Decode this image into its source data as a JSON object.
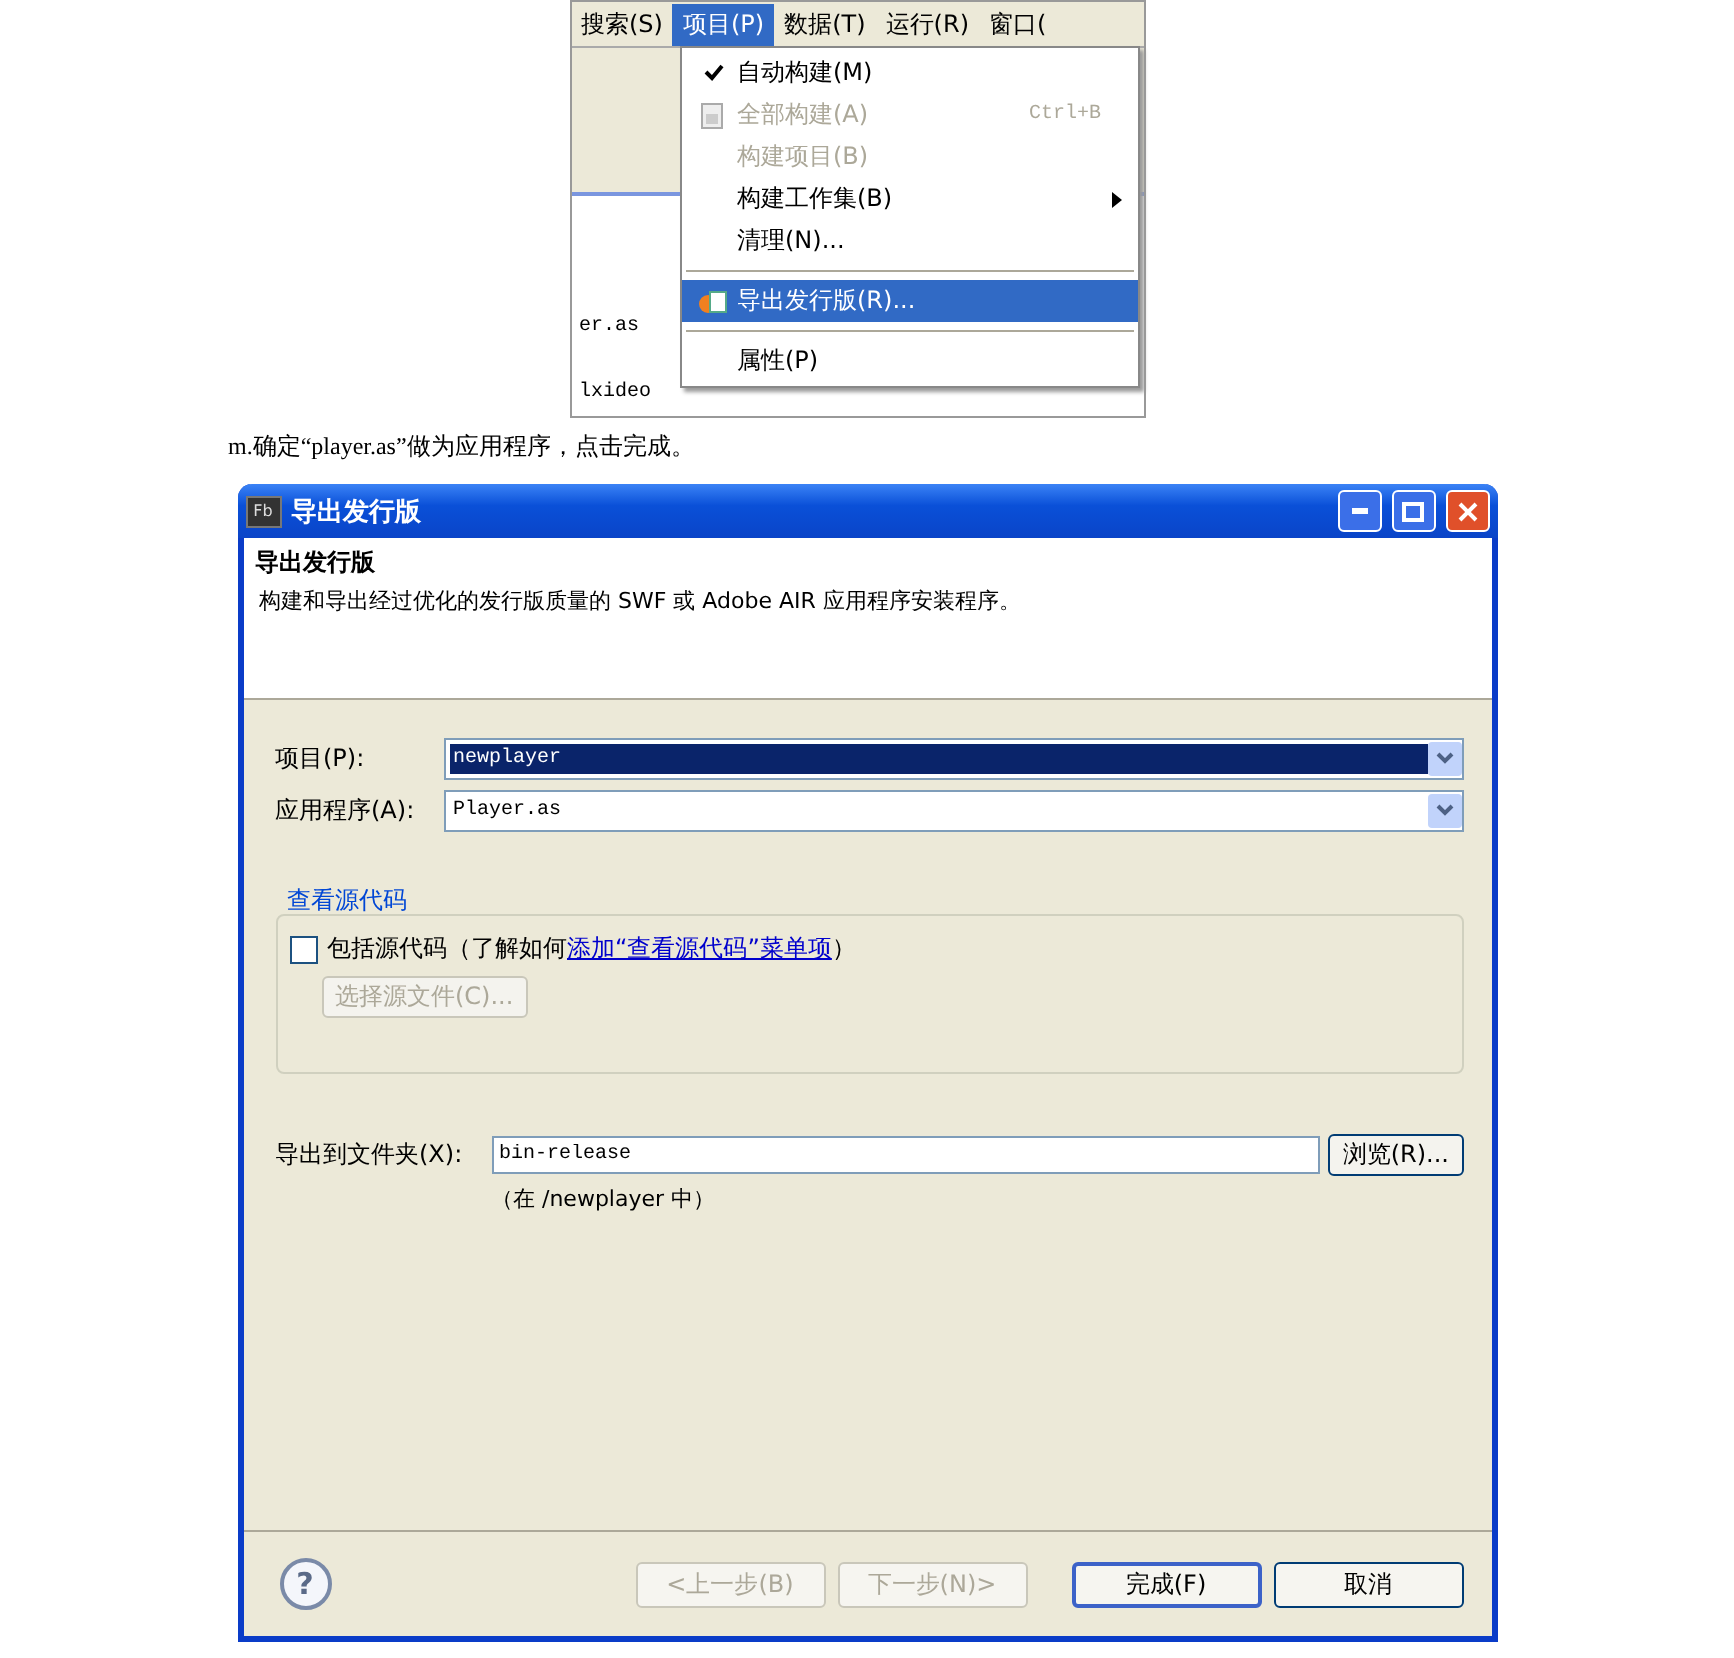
{
  "menu_screenshot": {
    "menubar": [
      {
        "label": "搜索(S)",
        "selected": false
      },
      {
        "label": "项目(P)",
        "selected": true
      },
      {
        "label": "数据(T)",
        "selected": false
      },
      {
        "label": "运行(R)",
        "selected": false
      },
      {
        "label": "窗口(",
        "selected": false
      }
    ],
    "editor_lines": [
      "er.as",
      "lxideo"
    ],
    "menu": [
      {
        "kind": "item",
        "label": "自动构建(M)",
        "checked": true,
        "disabled": false,
        "selected": false
      },
      {
        "kind": "icon_item",
        "label": "全部构建(A)",
        "shortcut": "Ctrl+B",
        "checked": false,
        "disabled": true,
        "selected": false
      },
      {
        "kind": "item",
        "label": "构建项目(B)",
        "checked": false,
        "disabled": true,
        "selected": false
      },
      {
        "kind": "item",
        "label": "构建工作集(B)",
        "submenu": true,
        "checked": false,
        "disabled": false,
        "selected": false
      },
      {
        "kind": "item",
        "label": "清理(N)...",
        "checked": false,
        "disabled": false,
        "selected": false
      },
      {
        "kind": "separator"
      },
      {
        "kind": "icon_item",
        "label": "导出发行版(R)...",
        "checked": false,
        "disabled": false,
        "selected": true
      },
      {
        "kind": "separator"
      },
      {
        "kind": "item",
        "label": "属性(P)",
        "checked": false,
        "disabled": false,
        "selected": false
      }
    ]
  },
  "caption": "m.确定“player.as”做为应用程序，点击完成。",
  "dialog": {
    "title": "导出发行版",
    "app_badge": "Fb",
    "heading": "导出发行版",
    "description": "构建和导出经过优化的发行版质量的 SWF 或 Adobe AIR 应用程序安装程序。",
    "fields": [
      {
        "label": "项目(P):",
        "value": "newplayer",
        "highlighted": true
      },
      {
        "label": "应用程序(A):",
        "value": "Player.as",
        "highlighted": false
      }
    ],
    "group": {
      "title": "查看源代码",
      "checkbox": {
        "label": "包括源代码（了解如何",
        "link": "添加“查看源代码”菜单项",
        "suffix": "）",
        "checked": false
      },
      "button": {
        "label": "选择源文件(C)...",
        "disabled": true
      }
    },
    "help": "?",
    "export": {
      "label": "导出到文件夹(X):",
      "value": "bin-release",
      "browse": "浏览(R)...",
      "note": "（在 /newplayer 中）"
    },
    "buttons": [
      {
        "label": "<上一步(B)",
        "disabled": true,
        "default": false
      },
      {
        "label": "下一步(N)>",
        "disabled": true,
        "default": false
      },
      {
        "label": "完成(F)",
        "disabled": false,
        "default": true
      },
      {
        "label": "取消",
        "disabled": false,
        "default": false
      }
    ]
  }
}
